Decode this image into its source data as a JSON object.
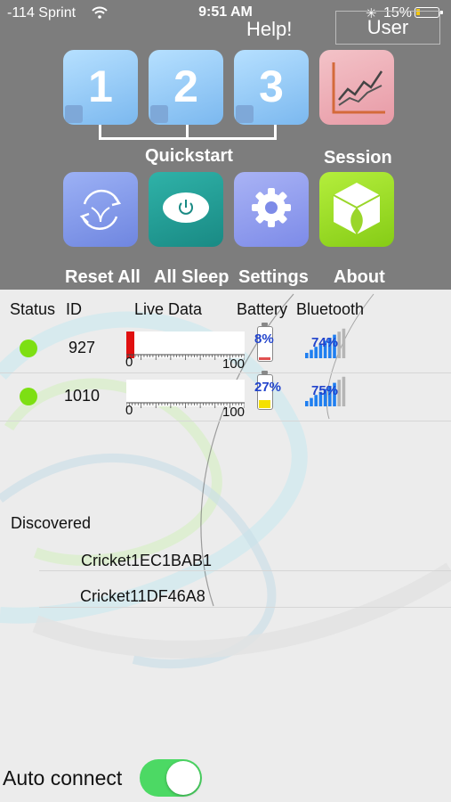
{
  "status_bar": {
    "carrier": "-114 Sprint",
    "time": "9:51 AM",
    "battery": "15%"
  },
  "top": {
    "help": "Help!",
    "user": "User"
  },
  "quickstart": {
    "tiles": [
      "1",
      "2",
      "3"
    ],
    "label": "Quickstart"
  },
  "session": {
    "label": "Session"
  },
  "actions": {
    "reset_all": "Reset All",
    "all_sleep": "All Sleep",
    "settings": "Settings",
    "about": "About"
  },
  "table": {
    "headers": {
      "status": "Status",
      "id": "ID",
      "live_data": "Live Data",
      "battery": "Battery",
      "bluetooth": "Bluetooth"
    },
    "scale_min": "0",
    "scale_max": "100",
    "rows": [
      {
        "id": "927",
        "live_fraction": 0.07,
        "battery": "8%",
        "battery_fraction": 0.08,
        "battery_color": "#e05050",
        "bluetooth": "74%",
        "status_color": "#7ddf13"
      },
      {
        "id": "1010",
        "live_fraction": 0.0,
        "battery": "27%",
        "battery_fraction": 0.27,
        "battery_color": "#f5e000",
        "bluetooth": "75%",
        "status_color": "#7ddf13"
      }
    ]
  },
  "discovered": {
    "label": "Discovered",
    "devices": [
      "Cricket1EC1BAB1",
      "Cricket11DF46A8"
    ]
  },
  "auto_connect": {
    "label": "Auto connect",
    "enabled": true
  },
  "colors": {
    "toggle_on": "#4cd964",
    "signal": "#1f7ff0",
    "panel": "#7d7d7d"
  }
}
